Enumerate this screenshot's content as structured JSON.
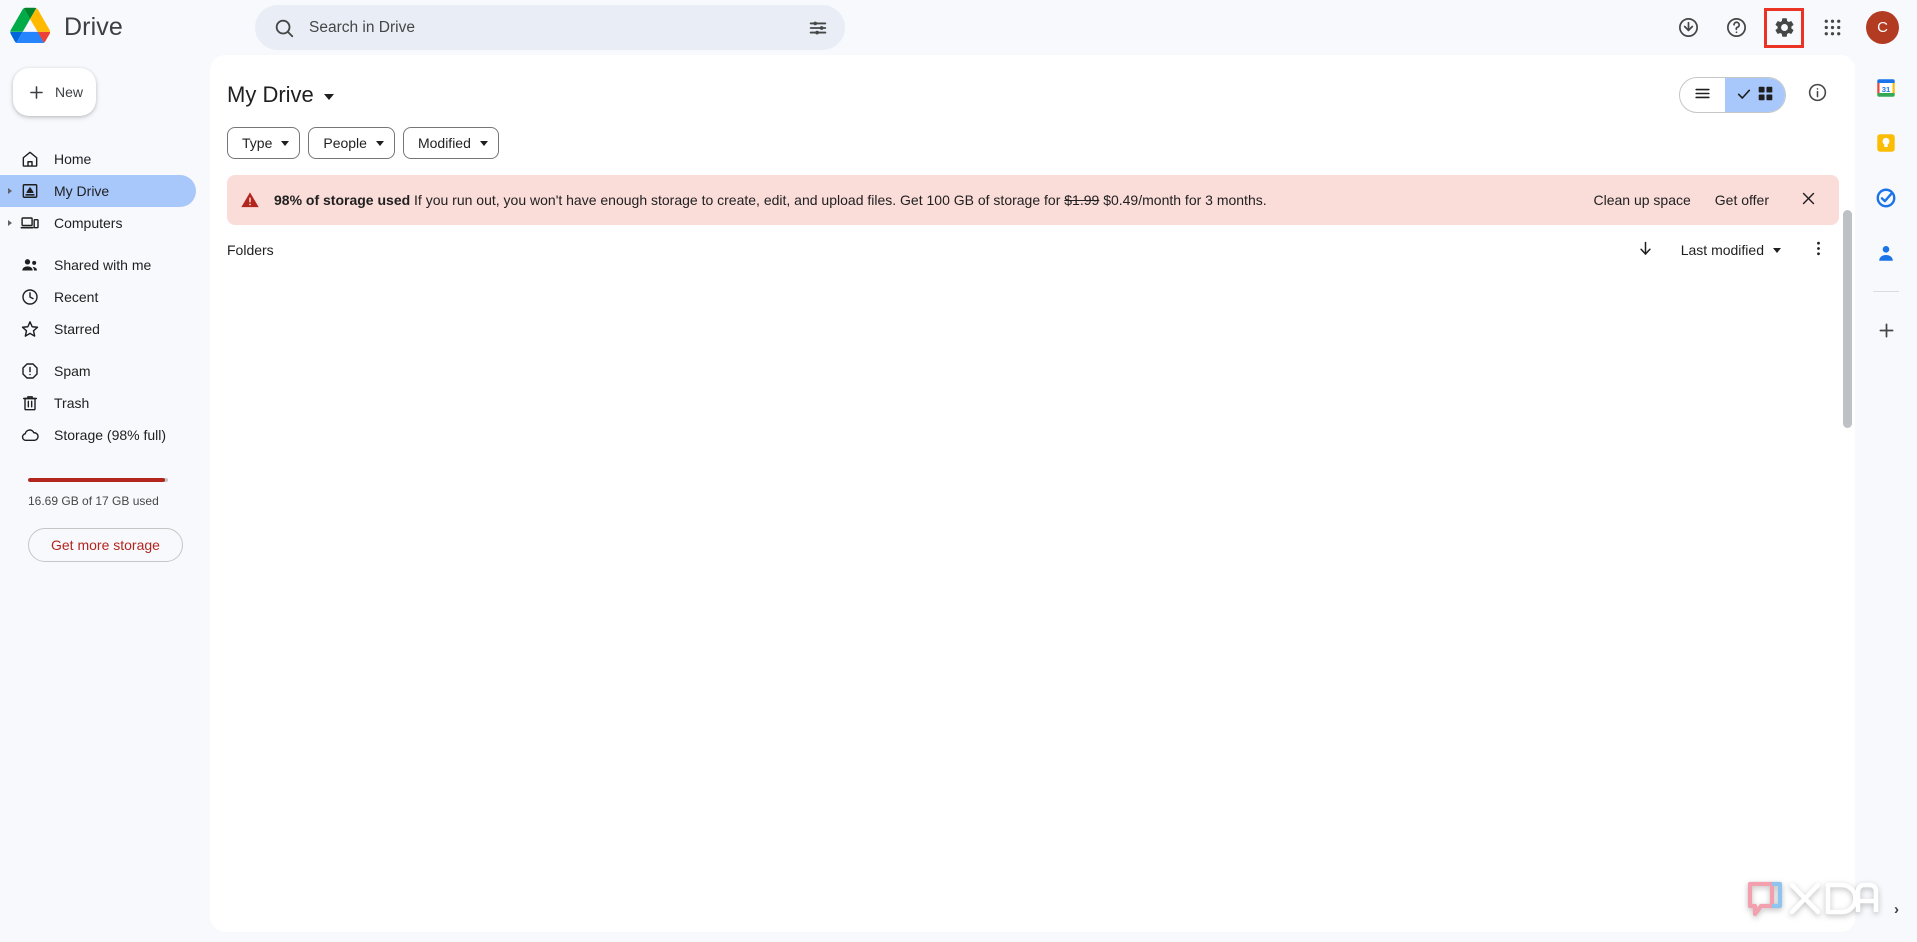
{
  "app": {
    "name": "Drive",
    "logo_icon": "drive-logo-icon"
  },
  "search": {
    "placeholder": "Search in Drive",
    "value": "",
    "search_icon": "search-icon",
    "options_icon": "tune-options-icon"
  },
  "top_actions": {
    "activity_label": "Activity",
    "help_label": "Support",
    "settings_label": "Settings",
    "apps_label": "Google apps",
    "avatar_initial": "C",
    "settings_highlighted": true,
    "highlight_color": "#ea3323"
  },
  "sidebar": {
    "new_button": "New",
    "groups": [
      {
        "items": [
          {
            "label": "Home",
            "icon": "home-icon",
            "active": false,
            "expandable": false
          },
          {
            "label": "My Drive",
            "icon": "my-drive-icon",
            "active": true,
            "expandable": true
          },
          {
            "label": "Computers",
            "icon": "computers-icon",
            "active": false,
            "expandable": true
          }
        ]
      },
      {
        "items": [
          {
            "label": "Shared with me",
            "icon": "people-icon",
            "active": false,
            "expandable": false
          },
          {
            "label": "Recent",
            "icon": "clock-icon",
            "active": false,
            "expandable": false
          },
          {
            "label": "Starred",
            "icon": "star-icon",
            "active": false,
            "expandable": false
          }
        ]
      },
      {
        "items": [
          {
            "label": "Spam",
            "icon": "spam-icon",
            "active": false,
            "expandable": false
          },
          {
            "label": "Trash",
            "icon": "trash-icon",
            "active": false,
            "expandable": false
          },
          {
            "label": "Storage (98% full)",
            "icon": "cloud-icon",
            "active": false,
            "expandable": false
          }
        ]
      }
    ],
    "storage": {
      "percent_used": 98,
      "usage_text": "16.69 GB of 17 GB used",
      "bar_color": "#b3261e",
      "get_more_label": "Get more storage"
    }
  },
  "main": {
    "title": "My Drive",
    "title_caret_icon": "chevron-down-icon",
    "chips": [
      {
        "label": "Type"
      },
      {
        "label": "People"
      },
      {
        "label": "Modified"
      }
    ],
    "view_toggle": {
      "list_icon": "list-view-icon",
      "grid_icon": "grid-view-icon",
      "check_icon": "check-icon",
      "selected": "grid",
      "selected_color": "#a8c7fa"
    },
    "info_icon": "info-icon",
    "banner": {
      "warning_icon": "warning-icon",
      "bold_text": "98% of storage used",
      "body_part1": "If you run out, you won't have enough storage to create, edit, and upload files. Get 100 GB of storage for",
      "old_price": "$1.99",
      "new_price": "$0.49",
      "body_part2": "/month for 3 months.",
      "clean_up_label": "Clean up space",
      "get_offer_label": "Get offer",
      "close_icon": "close-icon",
      "background_color": "#fadcd9"
    },
    "section": {
      "title": "Folders",
      "sort_direction_icon": "arrow-down-icon",
      "sort_by": "Last modified",
      "sort_caret_icon": "chevron-down-icon",
      "more_icon": "more-vertical-icon"
    }
  },
  "right_rail": {
    "items": [
      {
        "label": "Calendar",
        "icon": "calendar-icon"
      },
      {
        "label": "Keep",
        "icon": "keep-icon"
      },
      {
        "label": "Tasks",
        "icon": "tasks-icon"
      },
      {
        "label": "Contacts",
        "icon": "contacts-icon"
      }
    ],
    "add_label": "Get add-ons",
    "add_icon": "plus-icon",
    "expand_icon": "chevron-right-icon"
  },
  "watermark": {
    "text": "XDA"
  }
}
